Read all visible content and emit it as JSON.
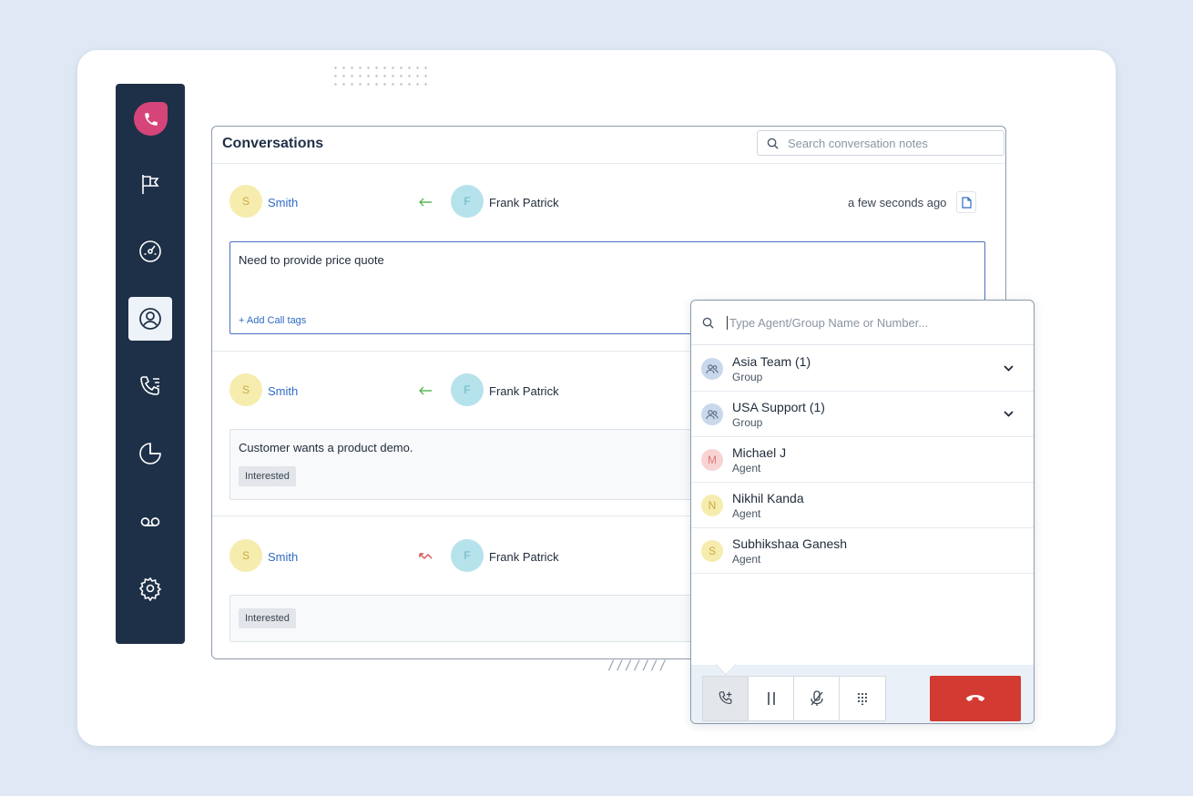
{
  "header": {
    "title": "Conversations",
    "search_placeholder": "Search conversation notes"
  },
  "sidebar": {
    "items": [
      {
        "icon": "flag-icon"
      },
      {
        "icon": "dashboard-icon"
      },
      {
        "icon": "user-circle-icon",
        "active": true
      },
      {
        "icon": "call-log-icon"
      },
      {
        "icon": "pie-chart-icon"
      },
      {
        "icon": "voicemail-icon"
      },
      {
        "icon": "gear-icon"
      }
    ]
  },
  "conversations": [
    {
      "from_initial": "S",
      "from": "Smith",
      "direction": "incoming",
      "to_initial": "F",
      "to": "Frank Patrick",
      "time": "a few seconds ago",
      "note": "Need to provide price quote",
      "add_tags_label": "+ Add Call tags"
    },
    {
      "from_initial": "S",
      "from": "Smith",
      "direction": "incoming",
      "to_initial": "F",
      "to": "Frank Patrick",
      "note": "Customer wants a product demo.",
      "tag": "Interested"
    },
    {
      "from_initial": "S",
      "from": "Smith",
      "direction": "missed",
      "to_initial": "F",
      "to": "Frank Patrick",
      "tag": "Interested"
    }
  ],
  "transfer": {
    "search_placeholder": "Type Agent/Group Name or Number...",
    "entries": [
      {
        "name": "Asia Team (1)",
        "type": "Group"
      },
      {
        "name": "USA Support (1)",
        "type": "Group"
      },
      {
        "initial": "M",
        "name": "Michael J",
        "type": "Agent"
      },
      {
        "initial": "N",
        "name": "Nikhil Kanda",
        "type": "Agent"
      },
      {
        "initial": "S",
        "name": "Subhikshaa Ganesh",
        "type": "Agent"
      }
    ]
  },
  "colors": {
    "sidebar": "#1e3048",
    "brand": "#d6457a",
    "link": "#2f6bc4",
    "hangup": "#d23a32"
  }
}
